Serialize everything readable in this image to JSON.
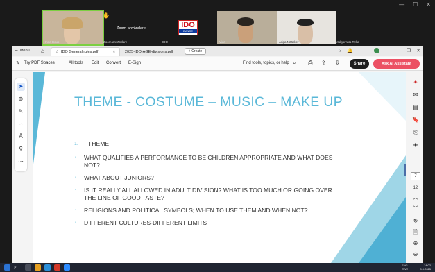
{
  "zoom": {
    "participants": [
      {
        "name": "Inna Bous"
      },
      {
        "name": "Zoom-användare",
        "label": "Zoom-användare"
      },
      {
        "name": "IDO"
      },
      {
        "name": "Vida"
      },
      {
        "name": "Ariga Nääcker"
      },
      {
        "name": "Malgorzata Rylia"
      }
    ],
    "ido_logo": {
      "big": "IDO",
      "small": "DANCE"
    },
    "window_controls": [
      "minimize-icon",
      "maximize-icon",
      "close-icon"
    ]
  },
  "acrobat": {
    "menu_label": "Menu",
    "tabs": [
      {
        "label": "IDO General rules.pdf",
        "active": true
      },
      {
        "label": "2025-IDO-AGE-divisions.pdf",
        "active": false
      }
    ],
    "create_label": "+ Create",
    "toolbar": {
      "try_spaces": "Try PDF Spaces",
      "all_tools": "All tools",
      "edit": "Edit",
      "convert": "Convert",
      "esign": "E-Sign",
      "find": "Find tools, topics, or help",
      "share": "Share",
      "ai": "Ask AI Assistant"
    },
    "page_number": "7",
    "page_total": "12"
  },
  "slide": {
    "title": "THEME - COSTUME – MUSIC – MAKE UP",
    "theme_num": "1.",
    "theme_label": "THEME",
    "bullets": [
      "WHAT QUALIFIES A PERFORMANCE TO BE CHILDREN APPROPRIATE AND WHAT DOES NOT?",
      "WHAT ABOUT JUNIORS?",
      "IS IT REALLY ALL ALLOWED IN ADULT DIVISION? WHAT IS TOO MUCH OR GOING OVER THE LINE OF GOOD TASTE?",
      "RELIGIONS AND POLITICAL SYMBOLS; WHEN TO USE THEM AND WHEN NOT?",
      "DIFFERENT CULTURES-DIFFERENT LIMITS"
    ]
  },
  "taskbar": {
    "time": "14:02",
    "date": "8.9.2025",
    "lang": "ENG SWE"
  },
  "colors": {
    "accent_title": "#5ab8d8",
    "share_bg": "#1d1d1d",
    "ai_bg": "#ec5063",
    "active_speaker": "#7ccf42"
  }
}
